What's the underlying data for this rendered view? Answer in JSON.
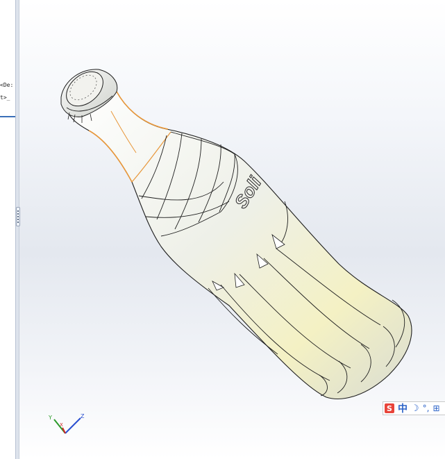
{
  "feature_tree": {
    "line1": "<De:",
    "line2": "t>_"
  },
  "model": {
    "logo_text": "Soli",
    "body_color": "#eef0e6",
    "highlight_color": "#f3f0b8",
    "selection_color": "#e8973a"
  },
  "triad": {
    "y_label": "Y",
    "x_label": "X",
    "z_label": "Z",
    "y_color": "#2a9a2a",
    "x_color": "#d02525",
    "z_color": "#2a4fd0"
  },
  "ime": {
    "logo": "S",
    "mode": "中",
    "moon": "☽",
    "punct": "°,",
    "grid": "⊞"
  }
}
